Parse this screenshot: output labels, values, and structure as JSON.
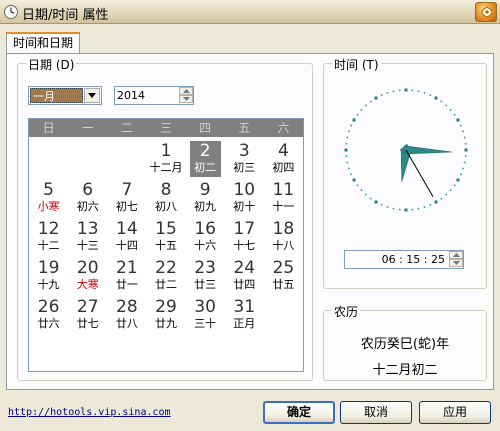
{
  "window": {
    "title": "日期/时间 属性"
  },
  "tabs": [
    {
      "label": "时间和日期"
    }
  ],
  "date_group": {
    "legend": "日期 (D)",
    "month_value": "一月",
    "year_value": "2014",
    "weekday_headers": [
      "日",
      "一",
      "二",
      "三",
      "四",
      "五",
      "六"
    ],
    "days": [
      {
        "d": "",
        "l": ""
      },
      {
        "d": "",
        "l": ""
      },
      {
        "d": "",
        "l": ""
      },
      {
        "d": "1",
        "l": "十二月",
        "lc": ""
      },
      {
        "d": "2",
        "l": "初二",
        "sel": true
      },
      {
        "d": "3",
        "l": "初三"
      },
      {
        "d": "4",
        "l": "初四"
      },
      {
        "d": "5",
        "l": "小寒",
        "red": true
      },
      {
        "d": "6",
        "l": "初六"
      },
      {
        "d": "7",
        "l": "初七"
      },
      {
        "d": "8",
        "l": "初八"
      },
      {
        "d": "9",
        "l": "初九"
      },
      {
        "d": "10",
        "l": "初十"
      },
      {
        "d": "11",
        "l": "十一"
      },
      {
        "d": "12",
        "l": "十二"
      },
      {
        "d": "13",
        "l": "十三"
      },
      {
        "d": "14",
        "l": "十四"
      },
      {
        "d": "15",
        "l": "十五"
      },
      {
        "d": "16",
        "l": "十六"
      },
      {
        "d": "17",
        "l": "十七"
      },
      {
        "d": "18",
        "l": "十八"
      },
      {
        "d": "19",
        "l": "十九"
      },
      {
        "d": "20",
        "l": "大寒",
        "red": true
      },
      {
        "d": "21",
        "l": "廿一"
      },
      {
        "d": "22",
        "l": "廿二"
      },
      {
        "d": "23",
        "l": "廿三"
      },
      {
        "d": "24",
        "l": "廿四"
      },
      {
        "d": "25",
        "l": "廿五"
      },
      {
        "d": "26",
        "l": "廿六"
      },
      {
        "d": "27",
        "l": "廿七"
      },
      {
        "d": "28",
        "l": "廿八"
      },
      {
        "d": "29",
        "l": "廿九"
      },
      {
        "d": "30",
        "l": "三十"
      },
      {
        "d": "31",
        "l": "正月"
      }
    ]
  },
  "time_group": {
    "legend": "时间 (T)",
    "time_value": "06 : 15 : 25",
    "clock": {
      "hour": 6,
      "minute": 15,
      "second": 25
    }
  },
  "lunar_group": {
    "legend": "农历",
    "line1": "农历癸巳(蛇)年",
    "line2": "十二月初二"
  },
  "footer": {
    "link": "http://hotools.vip.sina.com",
    "ok_label": "确定",
    "cancel_label": "取消",
    "apply_label": "应用"
  },
  "colors": {
    "accent": "#e68b2c",
    "selected_day": "#808080",
    "solar_term_red": "#cc0000",
    "clock_hands": "#2a8a8a"
  }
}
